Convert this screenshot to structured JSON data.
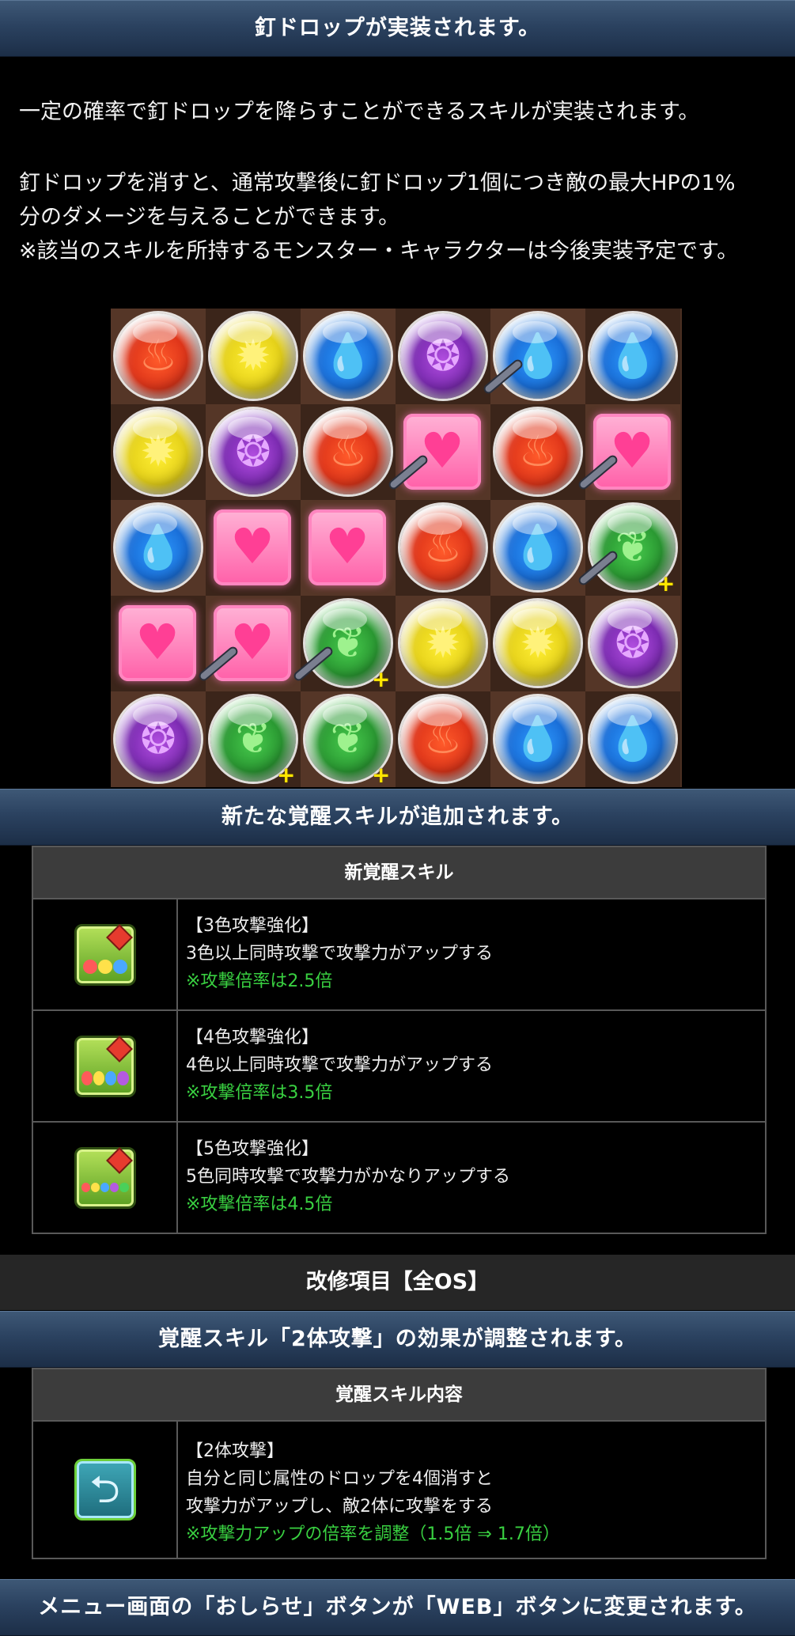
{
  "section1": {
    "header": "釘ドロップが実装されます。",
    "para1": "一定の確率で釘ドロップを降らすことができるスキルが実装されます。",
    "para2_line1": "釘ドロップを消すと、通常攻撃後に釘ドロップ1個につき敵の最大HPの1%",
    "para2_line2": "分のダメージを与えることができます。",
    "para2_line3": "※該当のスキルを所持するモンスター・キャラクターは今後実装予定です。"
  },
  "board": {
    "rows": [
      [
        "fire",
        "light",
        "water",
        "dark",
        "water-nail",
        "water"
      ],
      [
        "light",
        "dark",
        "fire",
        "heart-nail",
        "fire",
        "heart-nail"
      ],
      [
        "water",
        "heart",
        "heart",
        "fire",
        "water",
        "wood-nail-plus"
      ],
      [
        "heart",
        "heart-nail",
        "wood-nail-plus",
        "light",
        "light",
        "dark"
      ],
      [
        "dark",
        "wood-plus",
        "wood-plus",
        "fire",
        "water",
        "water"
      ]
    ]
  },
  "section2": {
    "header": "新たな覚醒スキルが追加されます。",
    "table_head": "新覚醒スキル",
    "rows": [
      {
        "icon": "three-color-attack-icon",
        "title": "【3色攻撃強化】",
        "desc": "3色以上同時攻撃で攻撃力がアップする",
        "note": "※攻撃倍率は2.5倍"
      },
      {
        "icon": "four-color-attack-icon",
        "title": "【4色攻撃強化】",
        "desc": "4色以上同時攻撃で攻撃力がアップする",
        "note": "※攻撃倍率は3.5倍"
      },
      {
        "icon": "five-color-attack-icon",
        "title": "【5色攻撃強化】",
        "desc": "5色同時攻撃で攻撃力がかなりアップする",
        "note": "※攻撃倍率は4.5倍"
      }
    ]
  },
  "section3": {
    "gray_header": "改修項目【全OS】",
    "header": "覚醒スキル「2体攻撃」の効果が調整されます。",
    "table_head": "覚醒スキル内容",
    "row": {
      "icon": "two-body-attack-icon",
      "title": "【2体攻撃】",
      "desc1": "自分と同じ属性のドロップを4個消すと",
      "desc2": "攻撃力がアップし、敵2体に攻撃をする",
      "note": "※攻撃力アップの倍率を調整（1.5倍 ⇒ 1.7倍）"
    }
  },
  "section4": {
    "header": "メニュー画面の「おしらせ」ボタンが「WEB」ボタンに変更されます。"
  }
}
